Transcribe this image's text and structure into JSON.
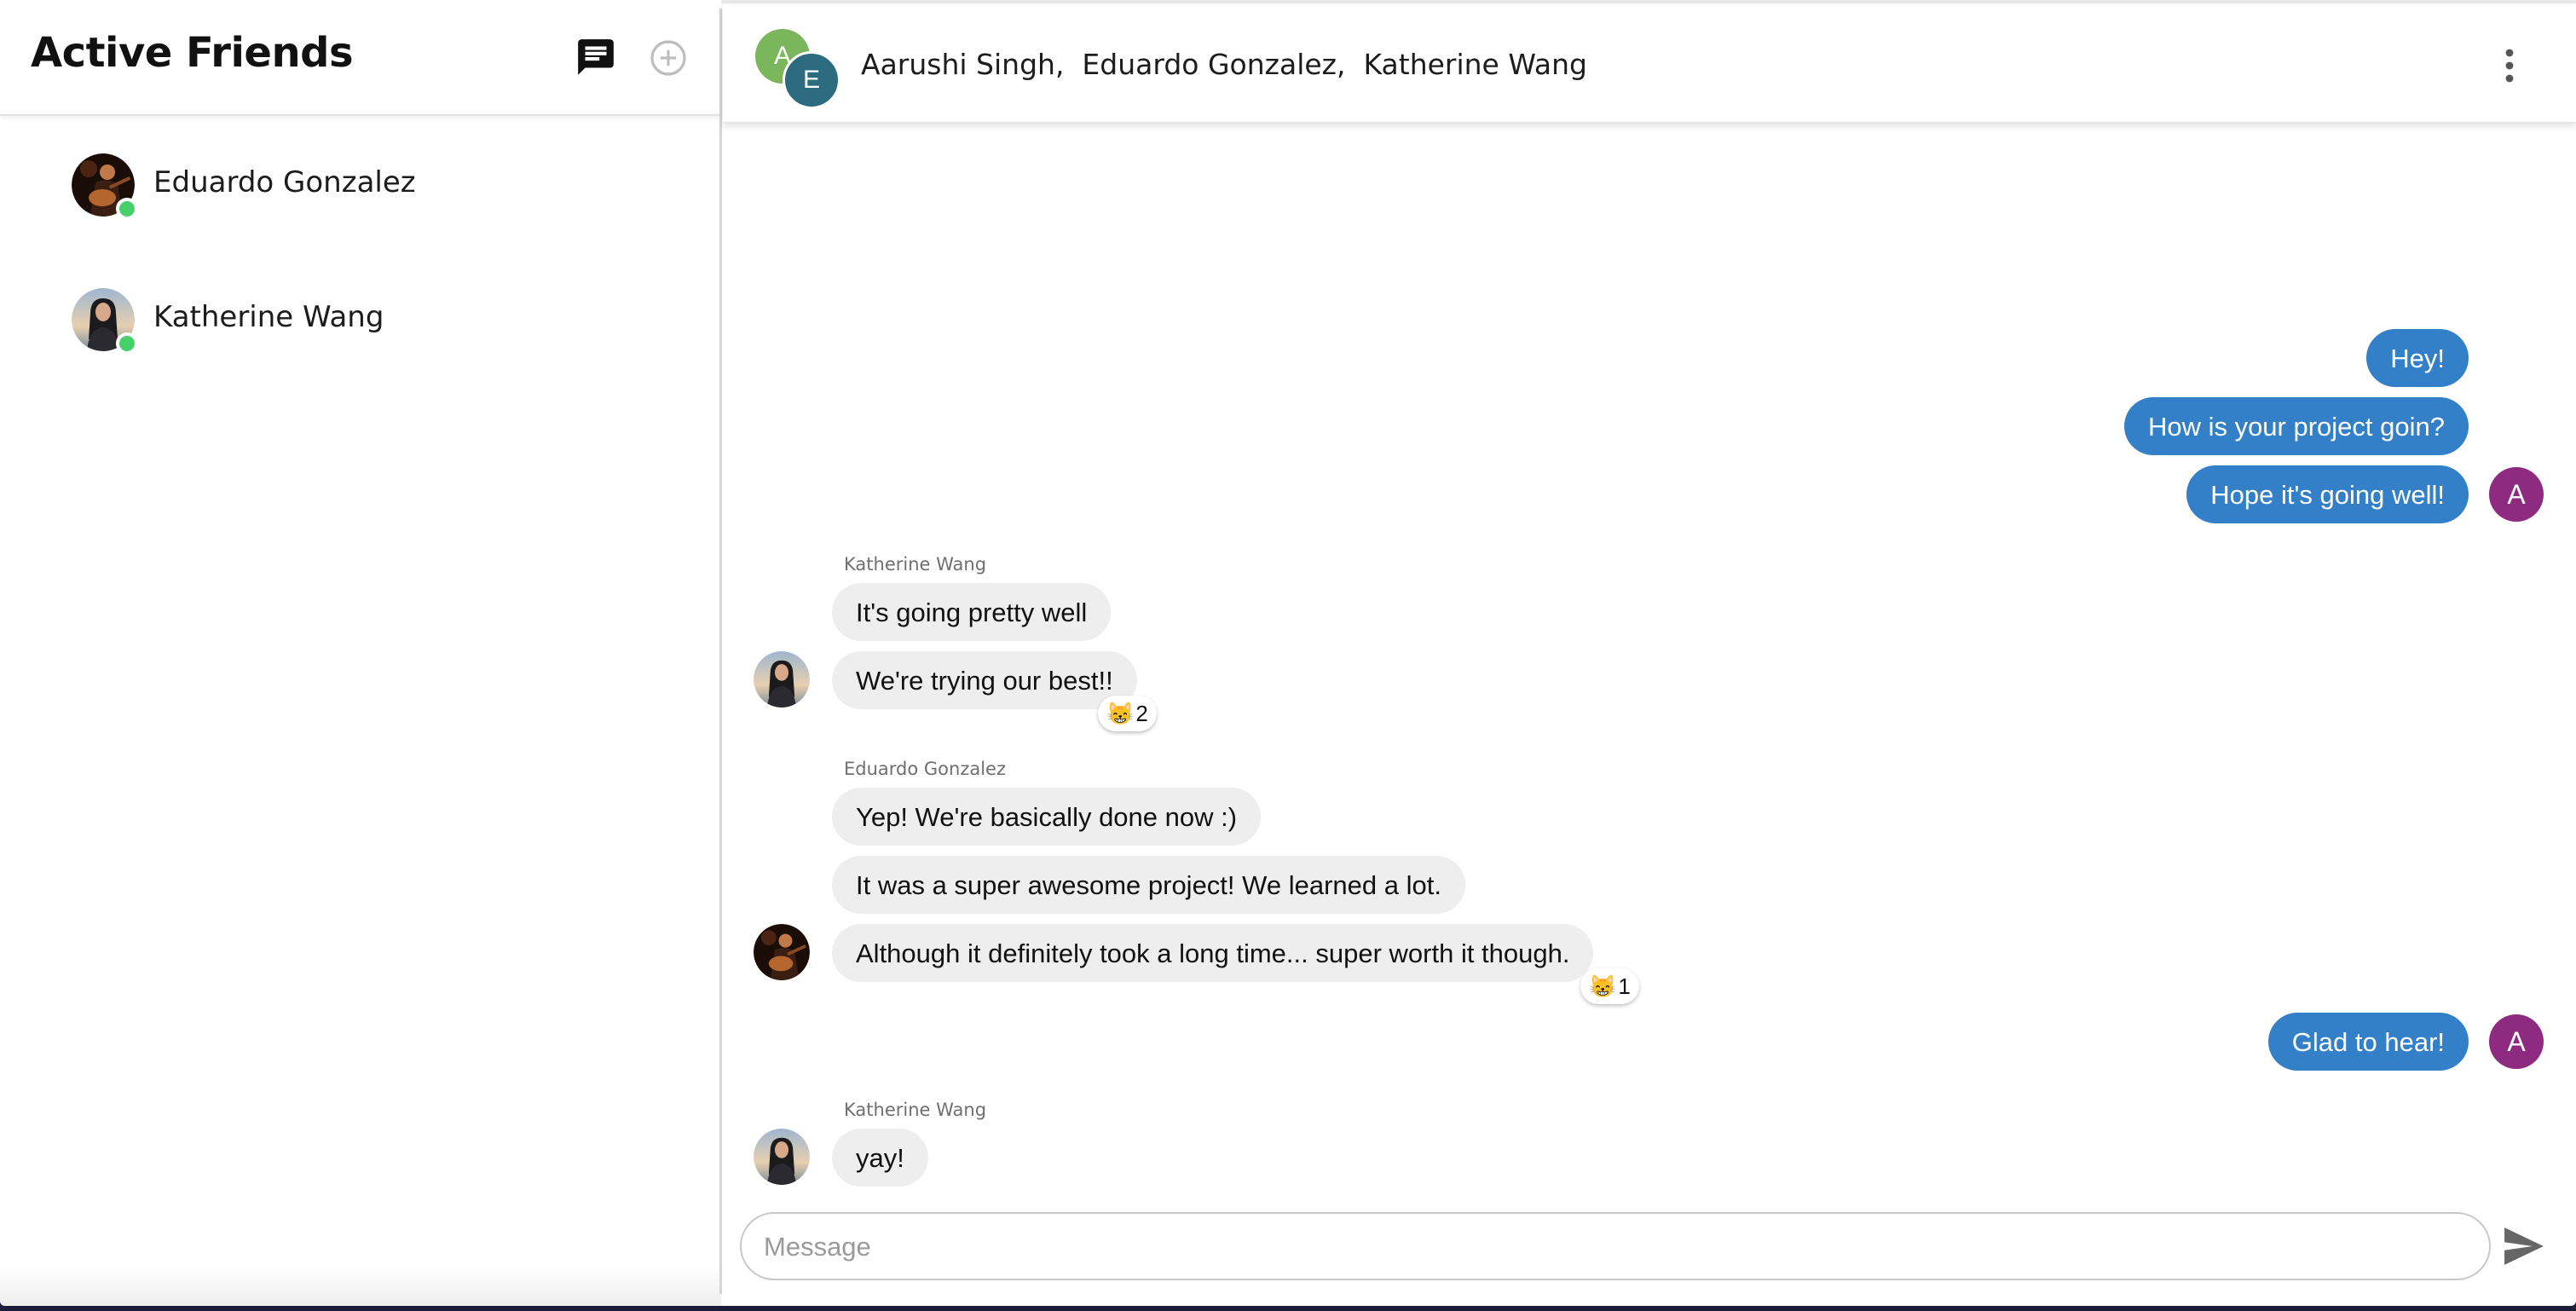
{
  "sidebar": {
    "title": "Active Friends",
    "icons": {
      "new_chat": "chat-icon",
      "add": "add-circle-icon"
    },
    "friends": [
      {
        "name": "Eduardo Gonzalez",
        "status": "online"
      },
      {
        "name": "Katherine Wang",
        "status": "online"
      }
    ]
  },
  "header": {
    "participants": [
      "Aarushi Singh,",
      "Eduardo Gonzalez,",
      "Katherine Wang"
    ],
    "group_avatar_initials": [
      "A",
      "E"
    ],
    "menu_icon": "more-vertical-icon"
  },
  "messages": {
    "sent_1": "Hey!",
    "sent_2": "How is your project goin?",
    "sent_3": "Hope it's going well!",
    "me_initial": "A",
    "sender_1": "Katherine Wang",
    "recv_1": "It's going pretty well",
    "recv_2": "We're trying our best!!",
    "reaction_1": {
      "emoji": "😸",
      "count": "2"
    },
    "sender_2": "Eduardo Gonzalez",
    "recv_3": "Yep! We're basically done now :)",
    "recv_4": "It was a super awesome project! We learned a lot.",
    "recv_5": "Although it definitely took a long time... super worth it though.",
    "reaction_2": {
      "emoji": "😸",
      "count": "1"
    },
    "sent_4": "Glad to hear!",
    "sender_3": "Katherine Wang",
    "recv_6": "yay!"
  },
  "composer": {
    "placeholder": "Message",
    "value": "",
    "send_icon": "send-icon"
  },
  "colors": {
    "sent_bubble": "#3380c8",
    "received_bubble": "#eeeeee",
    "me_avatar": "#8e2b81",
    "online": "#45d06a"
  }
}
